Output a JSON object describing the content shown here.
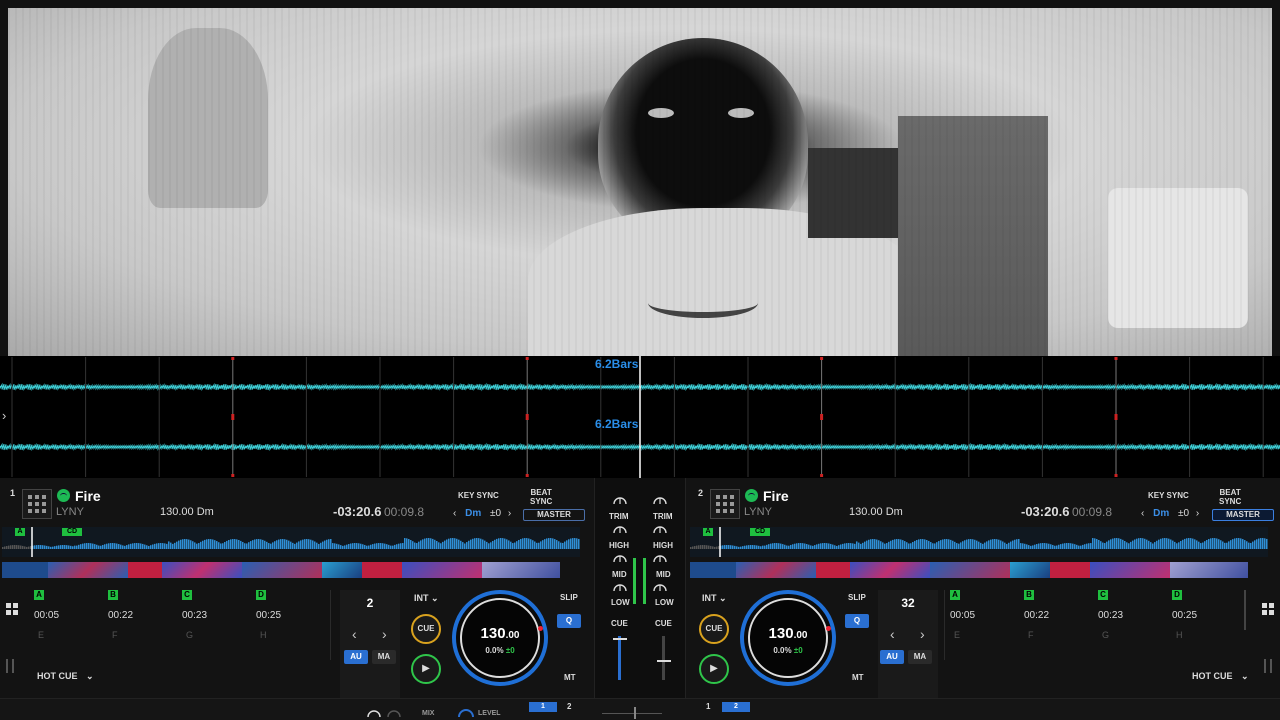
{
  "waveform": {
    "bar_label_top": "6.2Bars",
    "bar_label_bottom": "6.2Bars"
  },
  "deck_left": {
    "number": "1",
    "title": "Fire",
    "artist": "LYNY",
    "bpm_key": "130.00 Dm",
    "remaining": "-03:20.6",
    "elapsed": "00:09.8",
    "key_sync": "KEY SYNC",
    "beat_sync": "BEAT\nSYNC",
    "key_value": "Dm",
    "key_offset": "±0",
    "master": "MASTER",
    "overview_marker": "A",
    "overview_cd": "CD",
    "pads": [
      {
        "mark": "A",
        "time": "00:05"
      },
      {
        "mark": "B",
        "time": "00:22"
      },
      {
        "mark": "C",
        "time": "00:23"
      },
      {
        "mark": "D",
        "time": "00:25"
      }
    ],
    "pads2": [
      "E",
      "F",
      "G",
      "H"
    ],
    "hot_cue": "HOT CUE",
    "loop_size": "2",
    "au": "AU",
    "ma": "MA",
    "int": "INT",
    "cue": "CUE",
    "play": "▶",
    "platter_bpm": "130",
    "platter_bpm_dec": ".00",
    "platter_pct": "0.0%",
    "platter_offset": "±0",
    "slip": "SLIP",
    "q": "Q",
    "mt": "MT"
  },
  "deck_right": {
    "number": "2",
    "title": "Fire",
    "artist": "LYNY",
    "bpm_key": "130.00 Dm",
    "remaining": "-03:20.6",
    "elapsed": "00:09.8",
    "key_sync": "KEY SYNC",
    "beat_sync": "BEAT\nSYNC",
    "key_value": "Dm",
    "key_offset": "±0",
    "master": "MASTER",
    "overview_marker": "A",
    "overview_cd": "CD",
    "pads": [
      {
        "mark": "A",
        "time": "00:05"
      },
      {
        "mark": "B",
        "time": "00:22"
      },
      {
        "mark": "C",
        "time": "00:23"
      },
      {
        "mark": "D",
        "time": "00:25"
      }
    ],
    "pads2": [
      "E",
      "F",
      "G",
      "H"
    ],
    "hot_cue": "HOT CUE",
    "loop_size": "32",
    "au": "AU",
    "ma": "MA",
    "int": "INT",
    "cue": "CUE",
    "play": "▶",
    "platter_bpm": "130",
    "platter_bpm_dec": ".00",
    "platter_pct": "0.0%",
    "platter_offset": "±0",
    "slip": "SLIP",
    "q": "Q",
    "mt": "MT"
  },
  "mixer": {
    "trim": "TRIM",
    "high": "HIGH",
    "mid": "MID",
    "low": "LOW",
    "cue": "CUE"
  },
  "bottom_bar": {
    "mix": "MIX",
    "level": "LEVEL",
    "left_buttons": [
      "1",
      "2"
    ],
    "right_buttons": [
      "1",
      "2"
    ]
  },
  "colors": {
    "accent": "#2a6fd1",
    "waveform": "#3fd0d8",
    "hotcue": "#1fbf3f",
    "cue_ring": "#d9a21e",
    "play_ring": "#2fc54a"
  }
}
